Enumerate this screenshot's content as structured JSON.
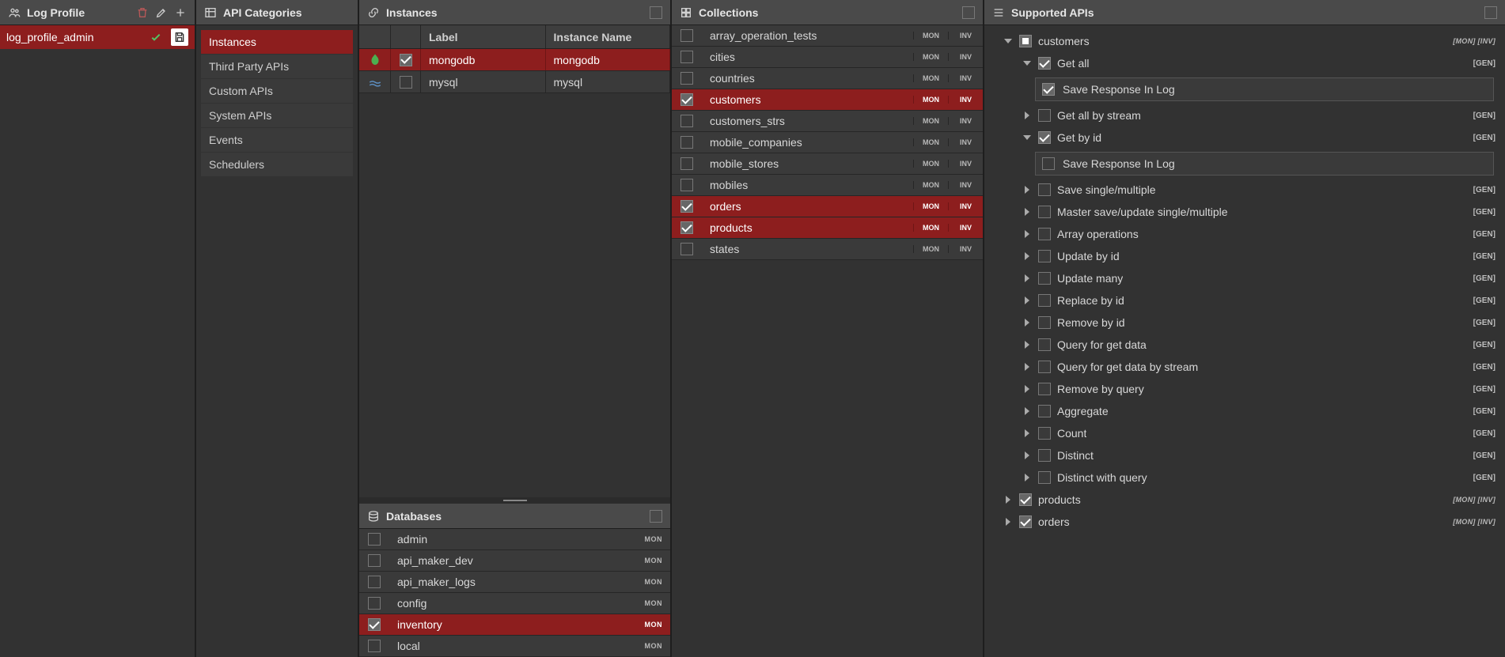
{
  "logProfile": {
    "title": "Log Profile",
    "item": "log_profile_admin"
  },
  "apiCategories": {
    "title": "API Categories",
    "items": [
      {
        "label": "Instances",
        "selected": true
      },
      {
        "label": "Third Party APIs",
        "selected": false
      },
      {
        "label": "Custom APIs",
        "selected": false
      },
      {
        "label": "System APIs",
        "selected": false
      },
      {
        "label": "Events",
        "selected": false
      },
      {
        "label": "Schedulers",
        "selected": false
      }
    ]
  },
  "instances": {
    "title": "Instances",
    "labelHeader": "Label",
    "nameHeader": "Instance Name",
    "rows": [
      {
        "type": "mongodb",
        "label": "mongodb",
        "name": "mongodb",
        "checked": true,
        "selected": true
      },
      {
        "type": "mysql",
        "label": "mysql",
        "name": "mysql",
        "checked": false,
        "selected": false
      }
    ]
  },
  "databases": {
    "title": "Databases",
    "rows": [
      {
        "name": "admin",
        "checked": false,
        "selected": false,
        "badges": [
          "MON"
        ]
      },
      {
        "name": "api_maker_dev",
        "checked": false,
        "selected": false,
        "badges": [
          "MON"
        ]
      },
      {
        "name": "api_maker_logs",
        "checked": false,
        "selected": false,
        "badges": [
          "MON"
        ]
      },
      {
        "name": "config",
        "checked": false,
        "selected": false,
        "badges": [
          "MON"
        ]
      },
      {
        "name": "inventory",
        "checked": true,
        "selected": true,
        "badges": [
          "MON"
        ]
      },
      {
        "name": "local",
        "checked": false,
        "selected": false,
        "badges": [
          "MON"
        ]
      }
    ]
  },
  "collections": {
    "title": "Collections",
    "rows": [
      {
        "name": "array_operation_tests",
        "checked": false,
        "selected": false,
        "badges": [
          "MON",
          "INV"
        ]
      },
      {
        "name": "cities",
        "checked": false,
        "selected": false,
        "badges": [
          "MON",
          "INV"
        ]
      },
      {
        "name": "countries",
        "checked": false,
        "selected": false,
        "badges": [
          "MON",
          "INV"
        ]
      },
      {
        "name": "customers",
        "checked": true,
        "selected": true,
        "badges": [
          "MON",
          "INV"
        ]
      },
      {
        "name": "customers_strs",
        "checked": false,
        "selected": false,
        "badges": [
          "MON",
          "INV"
        ]
      },
      {
        "name": "mobile_companies",
        "checked": false,
        "selected": false,
        "badges": [
          "MON",
          "INV"
        ]
      },
      {
        "name": "mobile_stores",
        "checked": false,
        "selected": false,
        "badges": [
          "MON",
          "INV"
        ]
      },
      {
        "name": "mobiles",
        "checked": false,
        "selected": false,
        "badges": [
          "MON",
          "INV"
        ]
      },
      {
        "name": "orders",
        "checked": true,
        "selected": true,
        "badges": [
          "MON",
          "INV"
        ]
      },
      {
        "name": "products",
        "checked": true,
        "selected": true,
        "badges": [
          "MON",
          "INV"
        ]
      },
      {
        "name": "states",
        "checked": false,
        "selected": false,
        "badges": [
          "MON",
          "INV"
        ]
      }
    ]
  },
  "supportedApis": {
    "title": "Supported APIs",
    "groups": [
      {
        "name": "customers",
        "expanded": true,
        "checked": "mixed",
        "badges": [
          "[MON]",
          "[INV]"
        ],
        "children": [
          {
            "name": "Get all",
            "checked": true,
            "expanded": true,
            "tag": "[GEN]",
            "saveResponse": {
              "label": "Save Response In Log",
              "checked": true
            }
          },
          {
            "name": "Get all by stream",
            "checked": false,
            "expanded": false,
            "tag": "[GEN]"
          },
          {
            "name": "Get by id",
            "checked": true,
            "expanded": true,
            "tag": "[GEN]",
            "saveResponse": {
              "label": "Save Response In Log",
              "checked": false
            }
          },
          {
            "name": "Save single/multiple",
            "checked": false,
            "expanded": false,
            "tag": "[GEN]"
          },
          {
            "name": "Master save/update single/multiple",
            "checked": false,
            "expanded": false,
            "tag": "[GEN]"
          },
          {
            "name": "Array operations",
            "checked": false,
            "expanded": false,
            "tag": "[GEN]"
          },
          {
            "name": "Update by id",
            "checked": false,
            "expanded": false,
            "tag": "[GEN]"
          },
          {
            "name": "Update many",
            "checked": false,
            "expanded": false,
            "tag": "[GEN]"
          },
          {
            "name": "Replace by id",
            "checked": false,
            "expanded": false,
            "tag": "[GEN]"
          },
          {
            "name": "Remove by id",
            "checked": false,
            "expanded": false,
            "tag": "[GEN]"
          },
          {
            "name": "Query for get data",
            "checked": false,
            "expanded": false,
            "tag": "[GEN]"
          },
          {
            "name": "Query for get data by stream",
            "checked": false,
            "expanded": false,
            "tag": "[GEN]"
          },
          {
            "name": "Remove by query",
            "checked": false,
            "expanded": false,
            "tag": "[GEN]"
          },
          {
            "name": "Aggregate",
            "checked": false,
            "expanded": false,
            "tag": "[GEN]"
          },
          {
            "name": "Count",
            "checked": false,
            "expanded": false,
            "tag": "[GEN]"
          },
          {
            "name": "Distinct",
            "checked": false,
            "expanded": false,
            "tag": "[GEN]"
          },
          {
            "name": "Distinct with query",
            "checked": false,
            "expanded": false,
            "tag": "[GEN]"
          }
        ]
      },
      {
        "name": "products",
        "expanded": false,
        "checked": true,
        "badges": [
          "[MON]",
          "[INV]"
        ]
      },
      {
        "name": "orders",
        "expanded": false,
        "checked": true,
        "badges": [
          "[MON]",
          "[INV]"
        ]
      }
    ]
  }
}
